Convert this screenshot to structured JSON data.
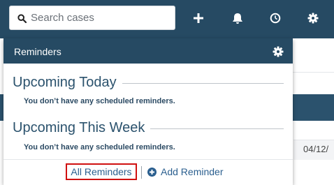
{
  "search": {
    "placeholder": "Search cases"
  },
  "topbar": {
    "icons": [
      "plus-icon",
      "bell-icon",
      "clock-icon",
      "gear-icon"
    ]
  },
  "background": {
    "date_fragment": "04/12/"
  },
  "reminders": {
    "title": "Reminders",
    "sections": [
      {
        "heading": "Upcoming Today",
        "empty_message": "You don’t have any scheduled reminders."
      },
      {
        "heading": "Upcoming This Week",
        "empty_message": "You don’t have any scheduled reminders."
      }
    ],
    "footer": {
      "all_label": "All Reminders",
      "add_label": "Add Reminder"
    }
  },
  "colors": {
    "navbar": "#264a63",
    "heading": "#2b526d",
    "link": "#2b5f8f",
    "highlight": "#d01010"
  }
}
